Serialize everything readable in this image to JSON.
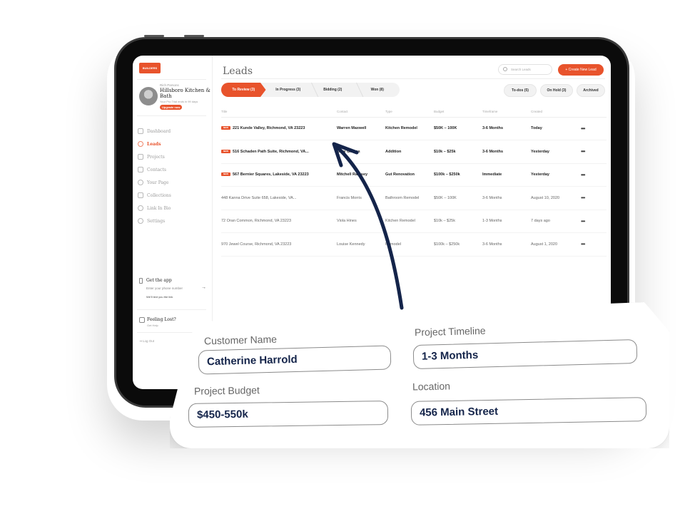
{
  "sidebar": {
    "logo_text": "BUILDERS",
    "profile": {
      "owner": "Rich Parsons",
      "business": "Hillsboro Kitchen & Bath",
      "trial": "Your Pro Trial ends in 99 days",
      "upgrade_label": "Upgrade now"
    },
    "items": [
      {
        "label": "Dashboard",
        "icon": "chart-icon",
        "active": false
      },
      {
        "label": "Leads",
        "icon": "target-icon",
        "active": true
      },
      {
        "label": "Projects",
        "icon": "projects-icon",
        "active": false
      },
      {
        "label": "Contacts",
        "icon": "contacts-icon",
        "active": false
      },
      {
        "label": "Your Page",
        "icon": "page-icon",
        "active": false
      },
      {
        "label": "Collections",
        "icon": "collections-icon",
        "active": false
      },
      {
        "label": "Link In Bio",
        "icon": "link-icon",
        "active": false
      },
      {
        "label": "Settings",
        "icon": "gear-icon",
        "active": false
      }
    ],
    "get_app": {
      "title": "Get the app",
      "placeholder": "Enter your phone number",
      "note": "We'll text you the link"
    },
    "help": {
      "title": "Feeling Lost?",
      "link": "Get Help"
    },
    "logout_label": "Log Out"
  },
  "main": {
    "title": "Leads",
    "search_placeholder": "Search Leads",
    "create_label": "+ Create New Lead",
    "pipeline": [
      {
        "label": "To Review (3)",
        "active": true
      },
      {
        "label": "In Progress (3)",
        "active": false
      },
      {
        "label": "Bidding (2)",
        "active": false
      },
      {
        "label": "Won (8)",
        "active": false
      }
    ],
    "filters": [
      {
        "label": "To-dos (5)"
      },
      {
        "label": "On Hold (3)"
      },
      {
        "label": "Archived"
      }
    ],
    "table": {
      "columns": [
        "Title",
        "Contact",
        "Type",
        "Budget",
        "Timeframe",
        "Created",
        ""
      ],
      "new_badge": "NEW",
      "more_label": "•••",
      "rows": [
        {
          "new": true,
          "title": "221 Kunde Valley, Richmond, VA 23223",
          "contact": "Warren Maxwell",
          "type": "Kitchen Remodel",
          "budget": "$50K – 100K",
          "timeframe": "3-6 Months",
          "created": "Today"
        },
        {
          "new": true,
          "title": "516 Schaden Path Suite, Richmond, VA...",
          "contact": "Gary Graves",
          "type": "Addition",
          "budget": "$10k – $25k",
          "timeframe": "3-6 Months",
          "created": "Yesterday"
        },
        {
          "new": true,
          "title": "567 Bernier Squares, Lakeside, VA 23223",
          "contact": "Mitchell Ramsey",
          "type": "Gut Renovation",
          "budget": "$100k – $250k",
          "timeframe": "Immediate",
          "created": "Yesterday"
        },
        {
          "new": false,
          "title": "448 Kanna Drive Suite 658, Lakeside, VA...",
          "contact": "Francis Morris",
          "type": "Bathroom Remodel",
          "budget": "$50K – 100K",
          "timeframe": "3-6 Months",
          "created": "August 10, 2020"
        },
        {
          "new": false,
          "title": "72 Oran Common, Richmond, VA 23223",
          "contact": "Viola Hines",
          "type": "Kitchen Remodel",
          "budget": "$10k – $25k",
          "timeframe": "1-3 Months",
          "created": "7 days ago"
        },
        {
          "new": false,
          "title": "970 Jewel Course, Richmond, VA 23223",
          "contact": "Louise Kennedy",
          "type": "Remodel",
          "budget": "$100k – $250k",
          "timeframe": "3-6 Months",
          "created": "August 1, 2020"
        }
      ]
    }
  },
  "card": {
    "customer_name_label": "Customer Name",
    "customer_name_value": "Catherine Harrold",
    "timeline_label": "Project Timeline",
    "timeline_value": "1-3 Months",
    "budget_label": "Project Budget",
    "budget_value": "$450-550k",
    "location_label": "Location",
    "location_value": "456 Main Street"
  },
  "colors": {
    "accent": "#e8532c",
    "arrow": "#14244a",
    "field_text": "#14244a"
  }
}
